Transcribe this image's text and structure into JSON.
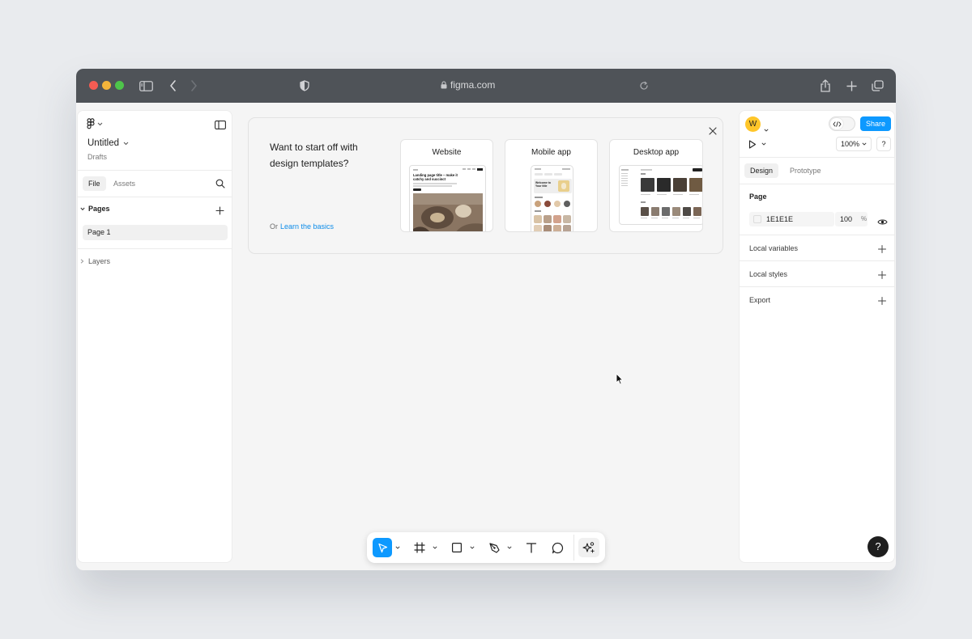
{
  "browser": {
    "url": "figma.com"
  },
  "left_panel": {
    "file_title": "Untitled",
    "file_location": "Drafts",
    "tabs": [
      "File",
      "Assets"
    ],
    "pages_label": "Pages",
    "pages": [
      "Page 1"
    ],
    "layers_label": "Layers"
  },
  "templates": {
    "heading": "Want to start off with design templates?",
    "or_text": "Or",
    "learn_link": "Learn the basics",
    "cards": [
      "Website",
      "Mobile app",
      "Desktop app"
    ],
    "website_thumb_title": "Landing page title – make it catchy and succinct",
    "mobile_thumb_title": "Welcome to Your title"
  },
  "toolbar": {
    "tools": [
      "move-tool",
      "frame-tool",
      "rectangle-tool",
      "pen-tool",
      "text-tool",
      "comment-tool",
      "ai-actions-tool"
    ]
  },
  "right_panel": {
    "avatar_letter": "W",
    "share_label": "Share",
    "zoom": "100%",
    "help_label": "?",
    "tabs": [
      "Design",
      "Prototype"
    ],
    "page_section": "Page",
    "bg_hex": "1E1E1E",
    "bg_opacity": "100",
    "bg_percent": "%",
    "sections": [
      "Local variables",
      "Local styles",
      "Export"
    ]
  },
  "colors": {
    "accent": "#0d99ff",
    "link": "#0c8ce9",
    "chrome": "#4f5358",
    "avatar": "#ffc62a"
  },
  "help_button": "?"
}
